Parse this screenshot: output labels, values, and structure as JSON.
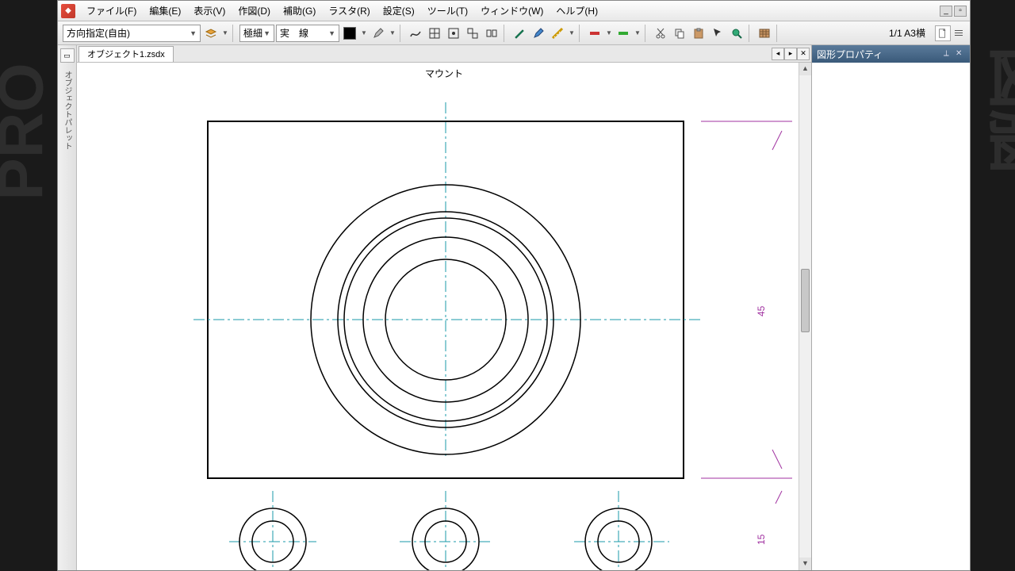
{
  "menu": {
    "file": "ファイル(F)",
    "edit": "編集(E)",
    "view": "表示(V)",
    "draw": "作図(D)",
    "aux": "補助(G)",
    "raster": "ラスタ(R)",
    "settings": "設定(S)",
    "tool": "ツール(T)",
    "window": "ウィンドウ(W)",
    "help": "ヘルプ(H)"
  },
  "toolbar": {
    "direction": "方向指定(自由)",
    "lineweight": "極細",
    "linestyle": "実　線",
    "page_status": "1/1 A3横"
  },
  "sidebar": {
    "palette_label": "オブジェクトパレット"
  },
  "doc": {
    "tab": "オブジェクト1.zsdx"
  },
  "panel": {
    "title": "図形プロパティ"
  },
  "drawing": {
    "title_fragment": "マウント",
    "dim1": "45",
    "dim2": "15"
  }
}
